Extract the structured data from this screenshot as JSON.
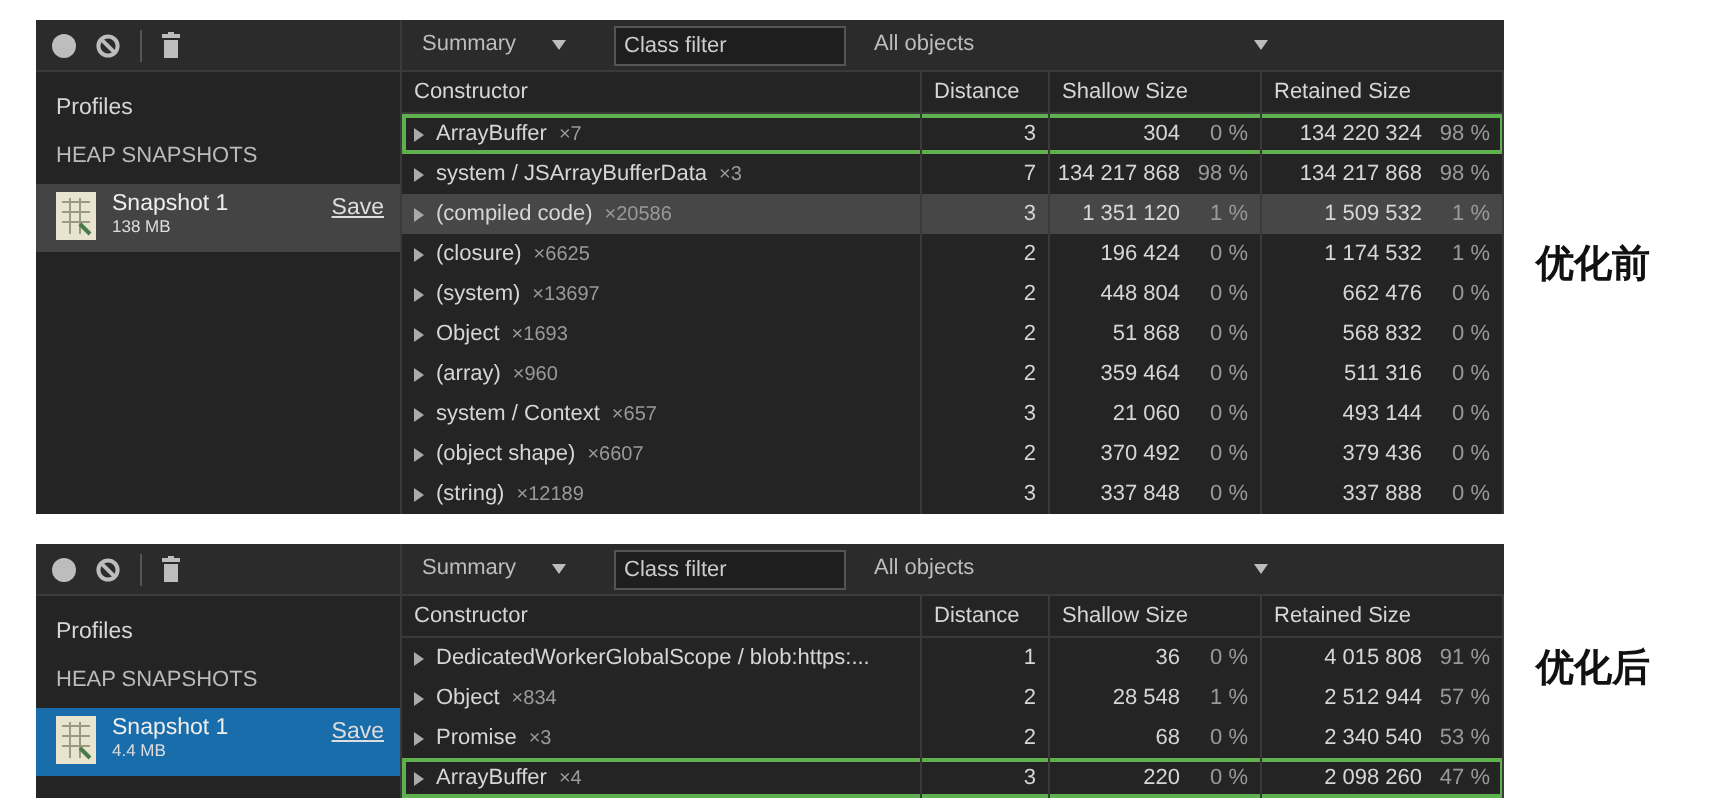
{
  "panels": [
    {
      "caption": "优化前",
      "toolbar": {
        "view": "Summary",
        "filter_placeholder": "Class filter",
        "scope": "All objects"
      },
      "sidebar": {
        "title": "Profiles",
        "section": "HEAP SNAPSHOTS",
        "snapshots": [
          {
            "name": "Snapshot 1",
            "size": "138 MB",
            "action": "Save",
            "selected": true,
            "focused": false
          }
        ]
      },
      "columns": [
        "Constructor",
        "Distance",
        "Shallow Size",
        "Retained Size"
      ],
      "rows": [
        {
          "name": "ArrayBuffer",
          "count": "×7",
          "distance": "3",
          "shallow": "304",
          "shallow_pct": "0 %",
          "retained": "134 220 324",
          "retained_pct": "98 %",
          "hovered": false,
          "outlined": true
        },
        {
          "name": "system / JSArrayBufferData",
          "count": "×3",
          "distance": "7",
          "shallow": "134 217 868",
          "shallow_pct": "98 %",
          "retained": "134 217 868",
          "retained_pct": "98 %",
          "hovered": false,
          "outlined": false
        },
        {
          "name": "(compiled code)",
          "count": "×20586",
          "distance": "3",
          "shallow": "1 351 120",
          "shallow_pct": "1 %",
          "retained": "1 509 532",
          "retained_pct": "1 %",
          "hovered": true,
          "outlined": false
        },
        {
          "name": "(closure)",
          "count": "×6625",
          "distance": "2",
          "shallow": "196 424",
          "shallow_pct": "0 %",
          "retained": "1 174 532",
          "retained_pct": "1 %",
          "hovered": false,
          "outlined": false
        },
        {
          "name": "(system)",
          "count": "×13697",
          "distance": "2",
          "shallow": "448 804",
          "shallow_pct": "0 %",
          "retained": "662 476",
          "retained_pct": "0 %",
          "hovered": false,
          "outlined": false
        },
        {
          "name": "Object",
          "count": "×1693",
          "distance": "2",
          "shallow": "51 868",
          "shallow_pct": "0 %",
          "retained": "568 832",
          "retained_pct": "0 %",
          "hovered": false,
          "outlined": false
        },
        {
          "name": "(array)",
          "count": "×960",
          "distance": "2",
          "shallow": "359 464",
          "shallow_pct": "0 %",
          "retained": "511 316",
          "retained_pct": "0 %",
          "hovered": false,
          "outlined": false
        },
        {
          "name": "system / Context",
          "count": "×657",
          "distance": "3",
          "shallow": "21 060",
          "shallow_pct": "0 %",
          "retained": "493 144",
          "retained_pct": "0 %",
          "hovered": false,
          "outlined": false
        },
        {
          "name": "(object shape)",
          "count": "×6607",
          "distance": "2",
          "shallow": "370 492",
          "shallow_pct": "0 %",
          "retained": "379 436",
          "retained_pct": "0 %",
          "hovered": false,
          "outlined": false
        },
        {
          "name": "(string)",
          "count": "×12189",
          "distance": "3",
          "shallow": "337 848",
          "shallow_pct": "0 %",
          "retained": "337 888",
          "retained_pct": "0 %",
          "hovered": false,
          "outlined": false
        }
      ]
    },
    {
      "caption": "优化后",
      "toolbar": {
        "view": "Summary",
        "filter_placeholder": "Class filter",
        "scope": "All objects"
      },
      "sidebar": {
        "title": "Profiles",
        "section": "HEAP SNAPSHOTS",
        "snapshots": [
          {
            "name": "Snapshot 1",
            "size": "4.4 MB",
            "action": "Save",
            "selected": true,
            "focused": true
          }
        ]
      },
      "columns": [
        "Constructor",
        "Distance",
        "Shallow Size",
        "Retained Size"
      ],
      "rows": [
        {
          "name": "DedicatedWorkerGlobalScope / blob:https:...",
          "distance": "1",
          "shallow": "36",
          "shallow_pct": "0 %",
          "retained": "4 015 808",
          "retained_pct": "91 %",
          "hovered": false,
          "outlined": false
        },
        {
          "name": "Object",
          "count": "×834",
          "distance": "2",
          "shallow": "28 548",
          "shallow_pct": "1 %",
          "retained": "2 512 944",
          "retained_pct": "57 %",
          "hovered": false,
          "outlined": false
        },
        {
          "name": "Promise",
          "count": "×3",
          "distance": "2",
          "shallow": "68",
          "shallow_pct": "0 %",
          "retained": "2 340 540",
          "retained_pct": "53 %",
          "hovered": false,
          "outlined": false
        },
        {
          "name": "ArrayBuffer",
          "count": "×4",
          "distance": "3",
          "shallow": "220",
          "shallow_pct": "0 %",
          "retained": "2 098 260",
          "retained_pct": "47 %",
          "hovered": false,
          "outlined": true
        }
      ]
    }
  ]
}
